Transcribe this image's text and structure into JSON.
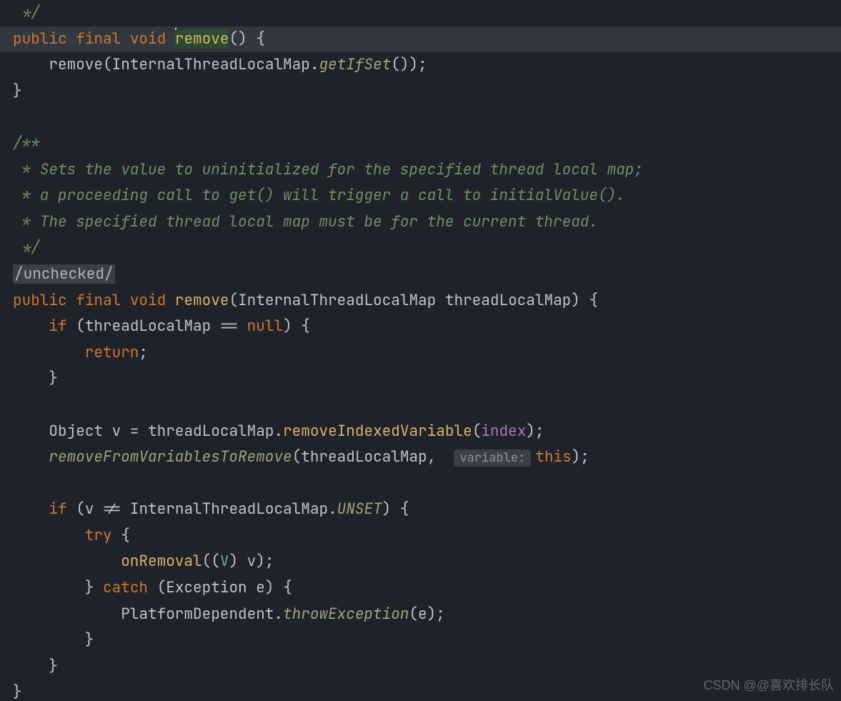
{
  "code": {
    "l0": {
      "comment_close": " */"
    },
    "l1": {
      "kw_public": "public",
      "kw_final": "final",
      "kw_void": "void",
      "fn": "remove",
      "paren_open": "(",
      "paren_close": ")",
      "brace": "{"
    },
    "l2": {
      "fn": "remove",
      "paren_open": "(",
      "type": "InternalThreadLocalMap",
      "dot": ".",
      "call": "getIfSet",
      "call_paren": "()",
      "paren_close": ")",
      "semi": ";"
    },
    "l3": {
      "brace": "}"
    },
    "l5": {
      "open": "/**"
    },
    "l6": {
      "text": " * Sets the value to uninitialized for the specified thread local map;"
    },
    "l7": {
      "text": " * a proceeding call to get() will trigger a call to initialValue()."
    },
    "l8": {
      "text": " * The specified thread local map must be for the current thread."
    },
    "l9": {
      "text": " */"
    },
    "l10": {
      "fold": "/unchecked/"
    },
    "l11": {
      "kw_public": "public",
      "kw_final": "final",
      "kw_void": "void",
      "fn": "remove",
      "paren_open": "(",
      "param_type": "InternalThreadLocalMap",
      "param_name": "threadLocalMap",
      "paren_close": ")",
      "brace": "{"
    },
    "l12": {
      "kw_if": "if",
      "paren_open": "(",
      "var": "threadLocalMap",
      "op": "==",
      "null": "null",
      "paren_close": ")",
      "brace": "{"
    },
    "l13": {
      "kw_return": "return",
      "semi": ";"
    },
    "l14": {
      "brace": "}"
    },
    "l16": {
      "type": "Object",
      "var": "v",
      "eq": "=",
      "obj": "threadLocalMap",
      "dot": ".",
      "call": "removeIndexedVariable",
      "paren_open": "(",
      "arg": "index",
      "paren_close": ")",
      "semi": ";"
    },
    "l17": {
      "call": "removeFromVariablesToRemove",
      "paren_open": "(",
      "arg1": "threadLocalMap",
      "comma": ",",
      "inlay": "variable:",
      "this": "this",
      "paren_close": ")",
      "semi": ";"
    },
    "l19": {
      "kw_if": "if",
      "paren_open": "(",
      "var": "v",
      "op": "!=",
      "type": "InternalThreadLocalMap",
      "dot": ".",
      "const": "UNSET",
      "paren_close": ")",
      "brace": "{"
    },
    "l20": {
      "kw_try": "try",
      "brace": "{"
    },
    "l21": {
      "call": "onRemoval",
      "paren_open": "(",
      "cast_open": "(",
      "cast_type": "V",
      "cast_close": ")",
      "var": "v",
      "paren_close": ")",
      "semi": ";"
    },
    "l22": {
      "brace_close": "}",
      "kw_catch": "catch",
      "paren_open": "(",
      "ex_type": "Exception",
      "ex_name": "e",
      "paren_close": ")",
      "brace": "{"
    },
    "l23": {
      "type": "PlatformDependent",
      "dot": ".",
      "call": "throwException",
      "paren_open": "(",
      "arg": "e",
      "paren_close": ")",
      "semi": ";"
    },
    "l24": {
      "brace": "}"
    },
    "l25": {
      "brace": "}"
    },
    "l26": {
      "brace": "}"
    }
  },
  "watermark": "CSDN @@喜欢排长队",
  "colors": {
    "bg": "#1f2229",
    "hl": "#33373f",
    "keyword": "#cc7832",
    "fn": "#d9b46c",
    "fn_italic": "#a0a57c",
    "comment": "#6f9165",
    "param": "#a57bb4",
    "generic": "#6f9ea5",
    "inlay_bg": "#3b3f47",
    "inlay_fg": "#8e949d",
    "default": "#bfc3cc",
    "selection": "#2f4a33"
  }
}
